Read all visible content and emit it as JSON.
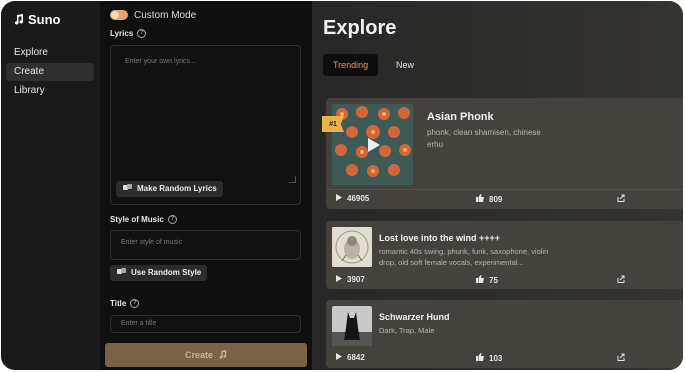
{
  "app": {
    "name": "Suno"
  },
  "sidebar": {
    "items": [
      {
        "label": "Explore"
      },
      {
        "label": "Create"
      },
      {
        "label": "Library"
      }
    ]
  },
  "create": {
    "custom_mode_label": "Custom Mode",
    "lyrics_label": "Lyrics",
    "lyrics_placeholder": "Enter your own lyrics...",
    "random_lyrics_button": "Make Random Lyrics",
    "style_label": "Style of Music",
    "style_placeholder": "Enter style of music",
    "random_style_button": "Use Random Style",
    "title_label": "Title",
    "title_placeholder": "Enter a title",
    "create_button": "Create"
  },
  "explore": {
    "title": "Explore",
    "tabs": [
      {
        "label": "Trending"
      },
      {
        "label": "New"
      }
    ],
    "songs": [
      {
        "rank": "#1",
        "title": "Asian Phonk",
        "tags": "phonk, clean shamisen, chinese erhu",
        "plays": "46905",
        "likes": "809"
      },
      {
        "title": "Lost love into the wind ++++",
        "tags": "romantic 40s swing, phunk, funk, saxophone, violin drop, old soft female vocals, experimental...",
        "plays": "3907",
        "likes": "75"
      },
      {
        "title": "Schwarzer Hund",
        "tags": "Dark, Trap, Male",
        "plays": "6842",
        "likes": "103"
      }
    ]
  },
  "colors": {
    "accent": "#f29a3f",
    "toggle": "#e0a572",
    "create_button": "#7a6246",
    "card": "#45423d"
  }
}
